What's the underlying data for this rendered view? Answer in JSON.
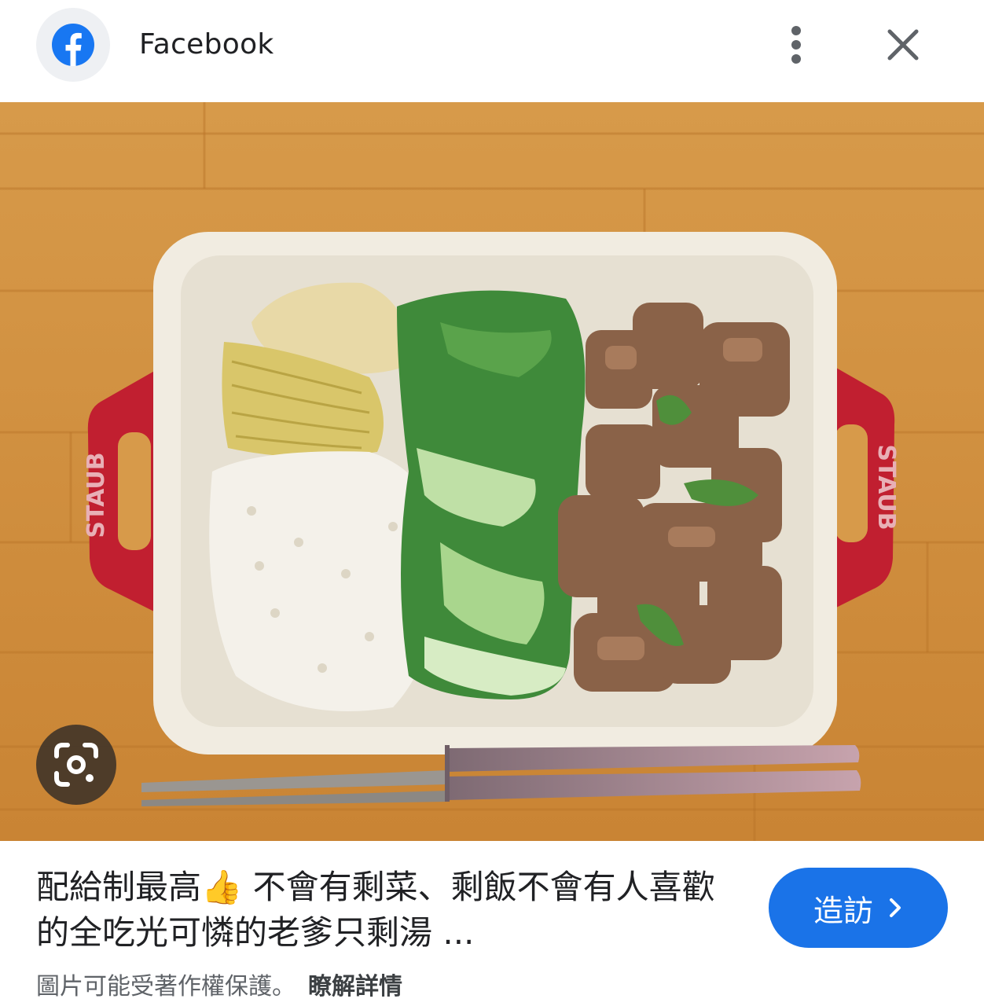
{
  "header": {
    "site_name": "Facebook",
    "logo_icon": "facebook-logo-icon",
    "more_icon": "more-vert-icon",
    "close_icon": "close-icon"
  },
  "image": {
    "lens_icon": "google-lens-icon",
    "dish_brand": "STAUB"
  },
  "caption": {
    "title": "配給制最高👍 不會有剩菜、剩飯不會有人喜歡的全吃光可憐的老爹只剩湯 ..."
  },
  "visit_button": {
    "label": "造訪",
    "icon": "chevron-right-icon"
  },
  "footer": {
    "notice": "圖片可能受著作權保護。",
    "learn_more": "瞭解詳情"
  },
  "colors": {
    "accent": "#1a73e8",
    "facebook_blue": "#1877f2"
  }
}
